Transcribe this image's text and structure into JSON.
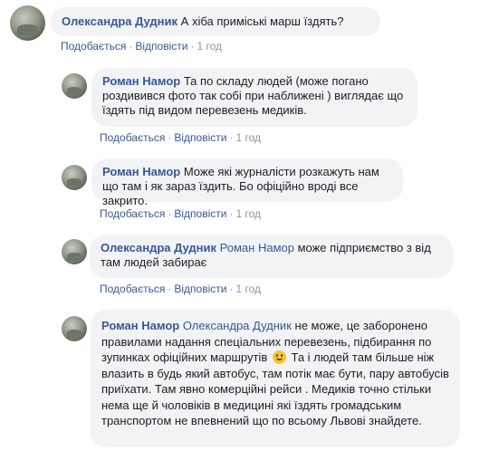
{
  "comments": [
    {
      "author": "Олександра Дудник",
      "text": "А хіба приміські марш їздять?",
      "like": "Подобається",
      "reply": "Відповісти",
      "time": "1 год"
    },
    {
      "author": "Роман Намор",
      "text": "Та по складу людей (може погано роздивився фото так собі при наближені ) виглядає що їздять під видом перевезень медиків.",
      "like": "Подобається",
      "reply": "Відповісти",
      "time": "1 год"
    },
    {
      "author": "Роман Намор",
      "text": "Може які журналісти розкажуть нам що там і як зараз їздить. Бо офіційно вроді все закрито.",
      "like": "Подобається",
      "reply": "Відповісти",
      "time": "1 год"
    },
    {
      "author": "Олександра Дудник",
      "mention": "Роман Намор",
      "text": "може підприємство з від там людей забирає",
      "like": "Подобається",
      "reply": "Відповісти",
      "time": "1 год"
    },
    {
      "author": "Роман Намор",
      "mention": "Олександра Дудник",
      "text_before_emoji": "не може, це заборонено правилами надання спеціальних перевезень, підбирання по зупинках офіційних маршрутів",
      "emoji": "smile-emoji",
      "text_after_emoji": "Та і людей там більше ніж влазить в будь який автобус, там потік має бути, пару автобусів приїхати. Там явно комерційні рейси . Медиків точно стільки нема ще й чоловіків в медицині які їздять громадським транспортом не впевнений що по всьому Львові знайдете."
    }
  ],
  "colors": {
    "link": "#385898",
    "bubble": "#f2f3f5",
    "meta": "#90949c"
  }
}
